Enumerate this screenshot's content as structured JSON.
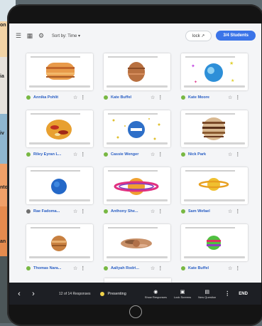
{
  "background": {
    "labels": [
      "on",
      "ia",
      "iv",
      "nto",
      "an"
    ]
  },
  "toolbar": {
    "sort_label": "Sort by: Time ▾",
    "lock_label": "lock ↗",
    "students_label": "3/4 Students"
  },
  "cards": [
    {
      "name": "Annika Pohlit",
      "status": "green"
    },
    {
      "name": "Kate Buffel",
      "status": "green"
    },
    {
      "name": "Kate Moore",
      "status": "green"
    },
    {
      "name": "Riley Eyran L...",
      "status": "green"
    },
    {
      "name": "Cassie Wenger",
      "status": "green"
    },
    {
      "name": "Nick Park",
      "status": "green"
    },
    {
      "name": "Rae Fadoma...",
      "status": "grey"
    },
    {
      "name": "Anthony She...",
      "status": "green"
    },
    {
      "name": "Sam Wefael",
      "status": "green"
    },
    {
      "name": "Thomas Nara...",
      "status": "green"
    },
    {
      "name": "Aaliyah Rodri...",
      "status": "green"
    },
    {
      "name": "Kate Buffel",
      "status": "green"
    }
  ],
  "bottombar": {
    "responses_label": "12 of 14 Responses",
    "presenting_label": "Presenting",
    "show_responses_label": "Show Responses",
    "lock_screens_label": "Lock Screens",
    "new_question_label": "New Question",
    "end_label": "END"
  },
  "icons": {
    "prev": "chevron-left-icon",
    "next": "chevron-right-icon",
    "star": "star-icon",
    "more": "more-icon"
  }
}
